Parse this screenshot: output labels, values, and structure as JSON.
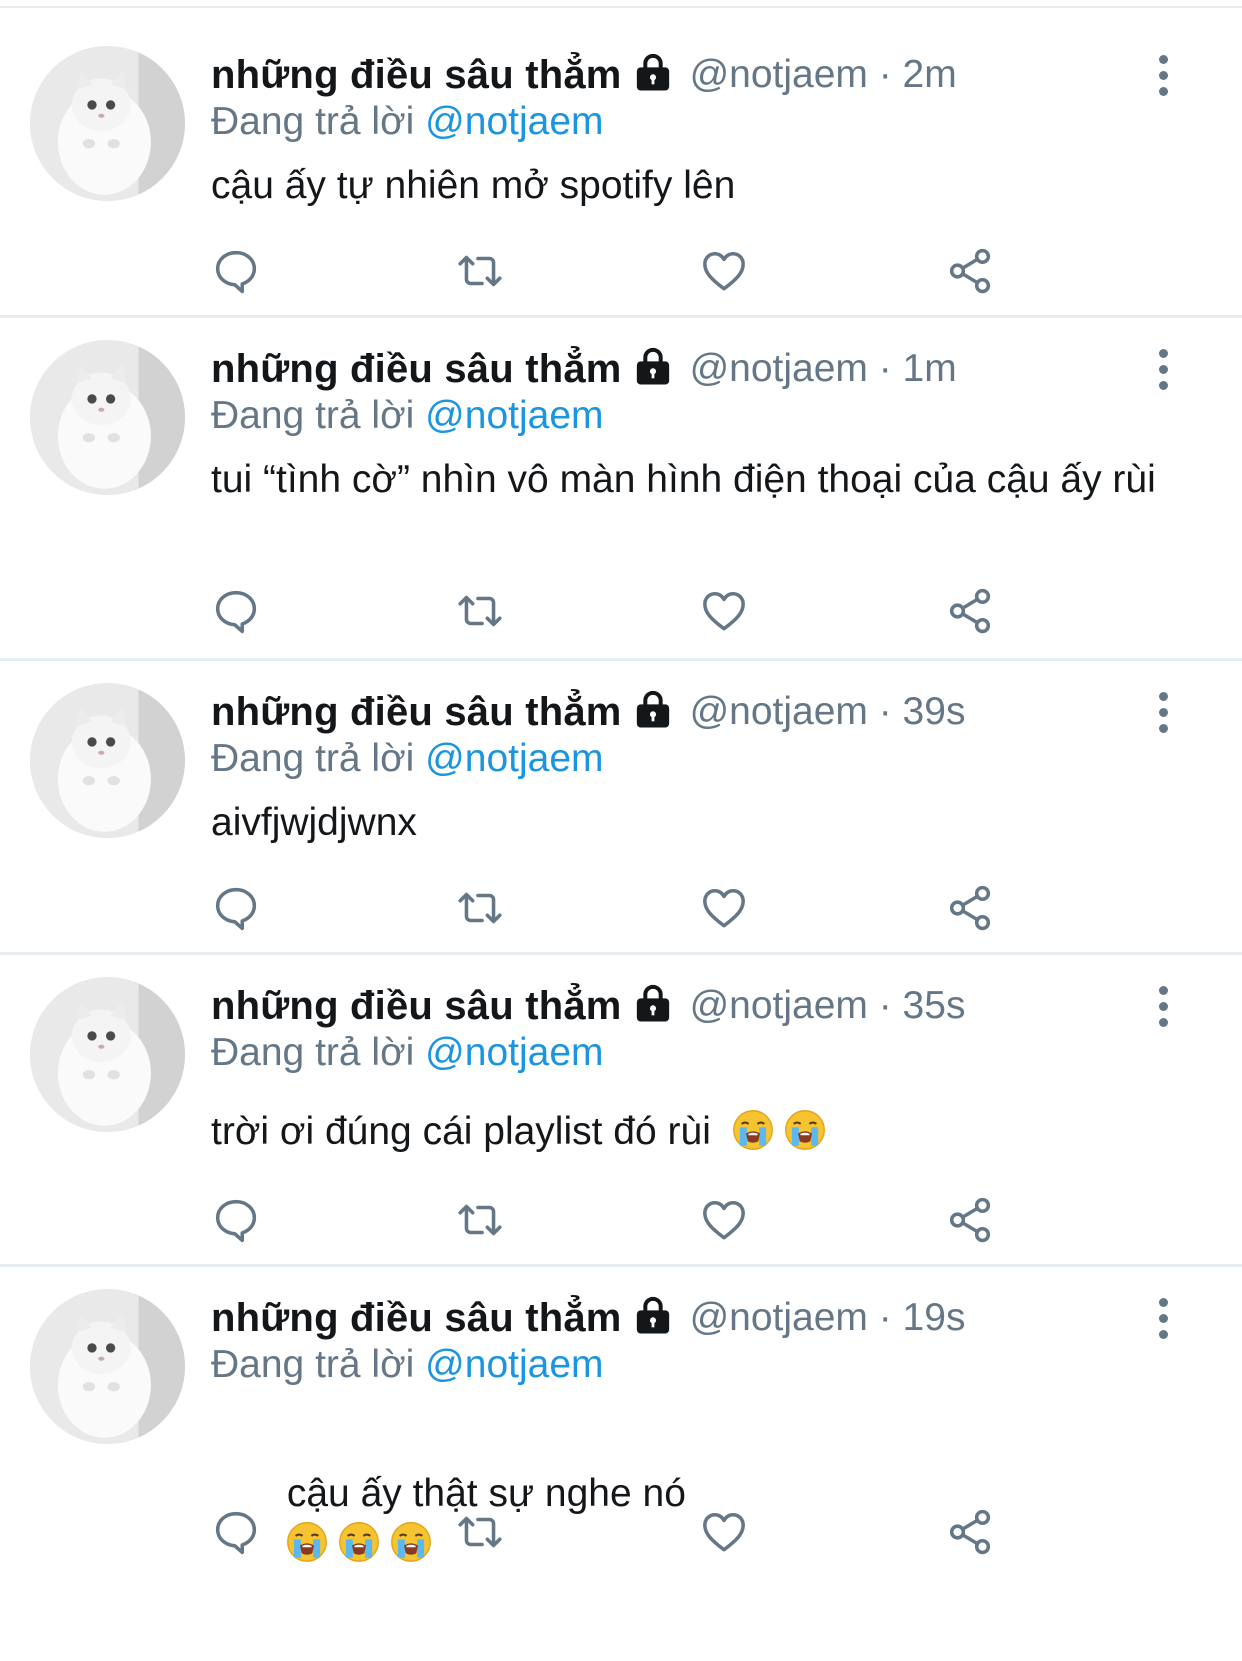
{
  "colors": {
    "primary_text": "#14171a",
    "secondary_text": "#657786",
    "accent": "#1b95e0",
    "divider": "#e6ecf0"
  },
  "tweets": [
    {
      "display_name": "những điều sâu thẳm",
      "handle_time": "@notjaem · 2m",
      "reply_prefix": "Đang trả lời",
      "reply_mention": "@notjaem",
      "text": "cậu ấy tự nhiên mở spotify lên",
      "emoji_count": 0
    },
    {
      "display_name": "những điều sâu thẳm",
      "handle_time": "@notjaem · 1m",
      "reply_prefix": "Đang trả lời",
      "reply_mention": "@notjaem",
      "text": "tui “tình cờ” nhìn vô màn hình điện thoại của cậu ấy rùi",
      "emoji_count": 0
    },
    {
      "display_name": "những điều sâu thẳm",
      "handle_time": "@notjaem · 39s",
      "reply_prefix": "Đang trả lời",
      "reply_mention": "@notjaem",
      "text": "aivfjwjdjwnx",
      "emoji_count": 0
    },
    {
      "display_name": "những điều sâu thẳm",
      "handle_time": "@notjaem · 35s",
      "reply_prefix": "Đang trả lời",
      "reply_mention": "@notjaem",
      "text": "trời ơi đúng cái playlist đó rùi",
      "emoji_count": 2
    },
    {
      "display_name": "những điều sâu thẳm",
      "handle_time": "@notjaem · 19s",
      "reply_prefix": "Đang trả lời",
      "reply_mention": "@notjaem",
      "text": " cậu ấy thật sự nghe nó",
      "emoji_count": 3
    }
  ],
  "icons": {
    "avatar": "cat-avatar",
    "protected": "lock-icon",
    "more": "more-options-icon",
    "reply": "reply-icon",
    "retweet": "retweet-icon",
    "like": "heart-icon",
    "share": "share-icon",
    "emoji": "loudly-crying-face-emoji"
  }
}
